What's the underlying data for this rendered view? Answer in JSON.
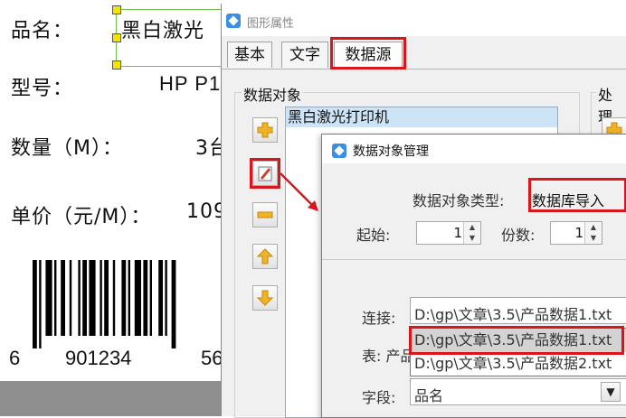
{
  "label_canvas": {
    "product_name_label": "品名：",
    "product_name_value": "黑白激光",
    "model_label": "型号：",
    "model_value": "HP P1",
    "quantity_label": "数量（M）：",
    "quantity_value": "3台",
    "price_label": "单价（元/M）：",
    "price_value": "109",
    "barcode_digits_left": "6",
    "barcode_digits_middle": "901234",
    "barcode_digits_right": "56"
  },
  "properties_window": {
    "title": "图形属性",
    "tabs": [
      {
        "label": "基本"
      },
      {
        "label": "文字"
      },
      {
        "label": "数据源"
      }
    ],
    "active_tab": "数据源",
    "data_object_group_label": "数据对象",
    "process_group_label": "处理",
    "data_objects": [
      "黑白激光打印机"
    ]
  },
  "data_object_dialog": {
    "title": "数据对象管理",
    "type_label": "数据对象类型:",
    "type_value": "数据库导入",
    "start_label": "起始:",
    "start_value": "1",
    "copies_label": "份数:",
    "copies_value": "1",
    "connection_label": "连接:",
    "connection_value": "D:\\gp\\文章\\3.5\\产品数据1.txt",
    "table_label": "表: 产品",
    "field_label": "字段:",
    "field_value": "品名",
    "dropdown_options": [
      "D:\\gp\\文章\\3.5\\产品数据1.txt",
      "D:\\gp\\文章\\3.5\\产品数据2.txt"
    ]
  },
  "colors": {
    "highlight_red": "#d9161c",
    "selection_green": "#6fbf4a",
    "handle_yellow": "#f5e400",
    "list_selection": "#cde4f7",
    "dropdown_selected": "#d3d3d3"
  },
  "icons": [
    "plus-icon",
    "edit-icon",
    "minus-icon",
    "arrow-up-icon",
    "arrow-down-icon",
    "app-icon",
    "chevron-down-icon",
    "red-arrow-icon"
  ]
}
